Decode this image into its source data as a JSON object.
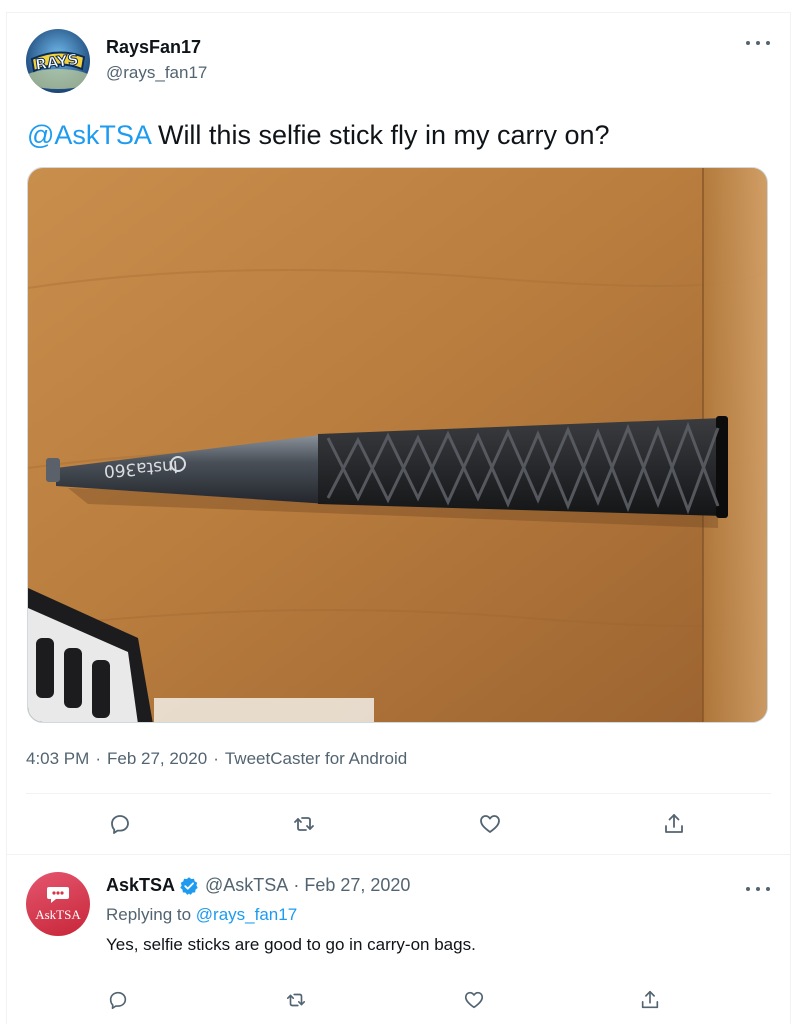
{
  "tweet": {
    "display_name": "RaysFan17",
    "handle": "@rays_fan17",
    "avatar_label": "RAYS",
    "mention": "@AskTSA",
    "body": " Will this selfie stick fly in my carry on?",
    "photo": {
      "subject": "selfie-stick-on-table",
      "brand_text": "Insta360"
    },
    "time": "4:03 PM",
    "date": "Feb 27, 2020",
    "source": "TweetCaster for Android",
    "separator": "·",
    "actions": [
      {
        "icon": "reply-icon"
      },
      {
        "icon": "retweet-icon"
      },
      {
        "icon": "like-icon"
      },
      {
        "icon": "share-icon"
      }
    ]
  },
  "reply": {
    "display_name": "AskTSA",
    "verified": true,
    "handle": "@AskTSA",
    "separator": "·",
    "date": "Feb 27, 2020",
    "replying_to_label": "Replying to ",
    "replying_to_handle": "@rays_fan17",
    "body": "Yes, selfie sticks are good to go in carry-on bags.",
    "avatar_label": "AskTSA",
    "actions": [
      {
        "icon": "reply-icon"
      },
      {
        "icon": "retweet-icon"
      },
      {
        "icon": "like-icon"
      },
      {
        "icon": "share-icon"
      }
    ]
  },
  "colors": {
    "accent": "#1d9bf0",
    "text": "#0f1419",
    "secondary": "#536471",
    "askTSA_avatar": "#d63445"
  }
}
